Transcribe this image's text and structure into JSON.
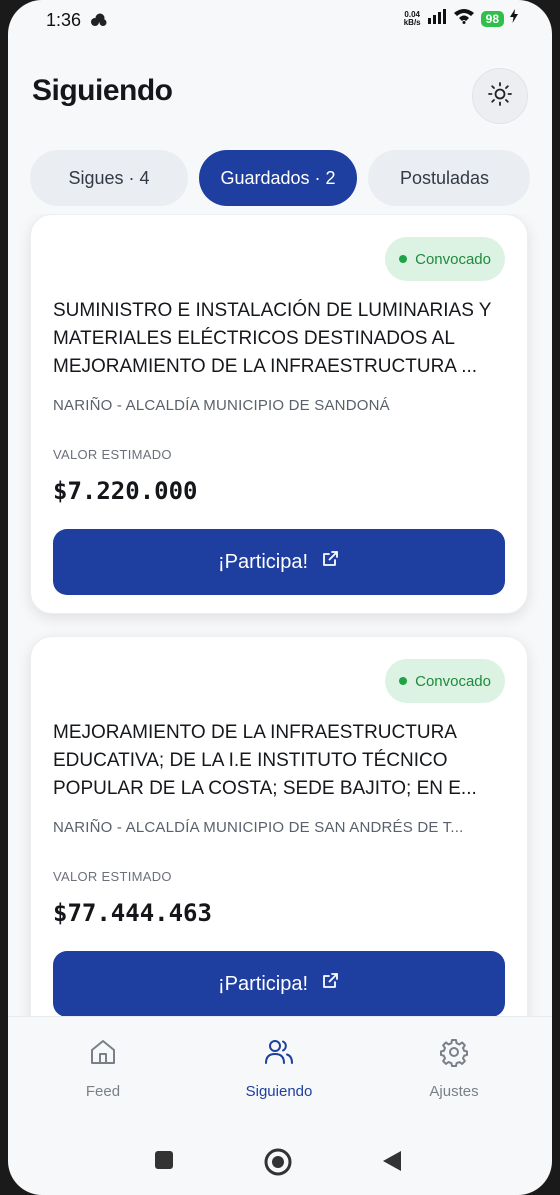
{
  "status_bar": {
    "time": "1:36",
    "net_speed_value": "0.04",
    "net_speed_unit": "kB/s",
    "battery": "98"
  },
  "header": {
    "title": "Siguiendo"
  },
  "tabs": [
    {
      "label": "Sigues · 4",
      "active": false
    },
    {
      "label": "Guardados · 2",
      "active": true
    },
    {
      "label": "Postuladas",
      "active": false
    }
  ],
  "cards": [
    {
      "status": "Convocado",
      "title": "SUMINISTRO E INSTALACIÓN DE LUMINARIAS Y MATERIALES ELÉCTRICOS DESTINADOS AL MEJORAMIENTO DE LA INFRAESTRUCTURA ...",
      "entity": "NARIÑO - ALCALDÍA MUNICIPIO DE SANDONÁ",
      "value_label": "VALOR ESTIMADO",
      "value": "$7.220.000",
      "cta": "¡Participa!"
    },
    {
      "status": "Convocado",
      "title": "MEJORAMIENTO DE LA INFRAESTRUCTURA EDUCATIVA; DE LA I.E INSTITUTO TÉCNICO POPULAR DE LA COSTA; SEDE BAJITO; EN E...",
      "entity": "NARIÑO - ALCALDÍA MUNICIPIO DE SAN ANDRÉS DE T...",
      "value_label": "VALOR ESTIMADO",
      "value": "$77.444.463",
      "cta": "¡Participa!"
    }
  ],
  "bottom_nav": [
    {
      "label": "Feed",
      "icon": "home-icon",
      "active": false
    },
    {
      "label": "Siguiendo",
      "icon": "users-icon",
      "active": true
    },
    {
      "label": "Ajustes",
      "icon": "gear-icon",
      "active": false
    }
  ],
  "colors": {
    "primary": "#1e3fa0",
    "badge_bg": "#dcf3e3",
    "badge_text": "#1e8b3c",
    "background": "#f7f8fa"
  }
}
